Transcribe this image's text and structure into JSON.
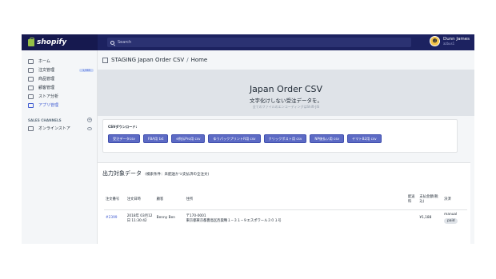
{
  "topbar": {
    "brand": "shopify",
    "search_placeholder": "Search",
    "user_name": "Dunn James",
    "user_store": "azbus1"
  },
  "sidebar": {
    "items": [
      {
        "label": "ホーム"
      },
      {
        "label": "注文管理",
        "badge": "1,965"
      },
      {
        "label": "商品管理"
      },
      {
        "label": "顧客管理"
      },
      {
        "label": "ストア分析"
      },
      {
        "label": "アプリ管理"
      }
    ],
    "section_title": "SALES CHANNELS",
    "channel": "オンラインストア"
  },
  "main": {
    "breadcrumb": [
      "STAGING Japan Order CSV",
      "Home"
    ],
    "breadcrumb_sep": "/",
    "header": {
      "title": "Japan Order CSV",
      "subtitle": "文字化けしない受注データを。",
      "note": "全てのファイルのエンコーディングはShift-JIS"
    },
    "csv": {
      "title": "CSVダウンロード:",
      "buttons": [
        "受注データcsv",
        "FBA用 txt",
        "e飛伝Pro用 csv",
        "ゆうパックプリントR用 csv",
        "クリックポスト用 csv",
        "NP後払い用 csv",
        "ヤマトB2用 csv"
      ]
    },
    "orders": {
      "title": "出力対象データ",
      "condition": "(検索条件：未配送かつ支払済の全注文)",
      "headers": [
        "注文番号",
        "注文日時",
        "顧客",
        "住所",
        "配送料",
        "支払金額(税込)",
        "決済"
      ],
      "rows": [
        {
          "order": "#2399",
          "date": "2018年 03月12日 11:30:42",
          "customer": "Benny Ben",
          "postal": "〒170-0001",
          "address": "東京都東京都豊島区西巣鴨１−３１−９エスポワール３０１号",
          "shipping": "",
          "amount": "¥1,188",
          "payment": "manual",
          "status": "paid"
        }
      ]
    }
  },
  "colors": {
    "topbar": "#1c2260",
    "accent": "#5c6ac4",
    "link": "#3f5bd1"
  }
}
